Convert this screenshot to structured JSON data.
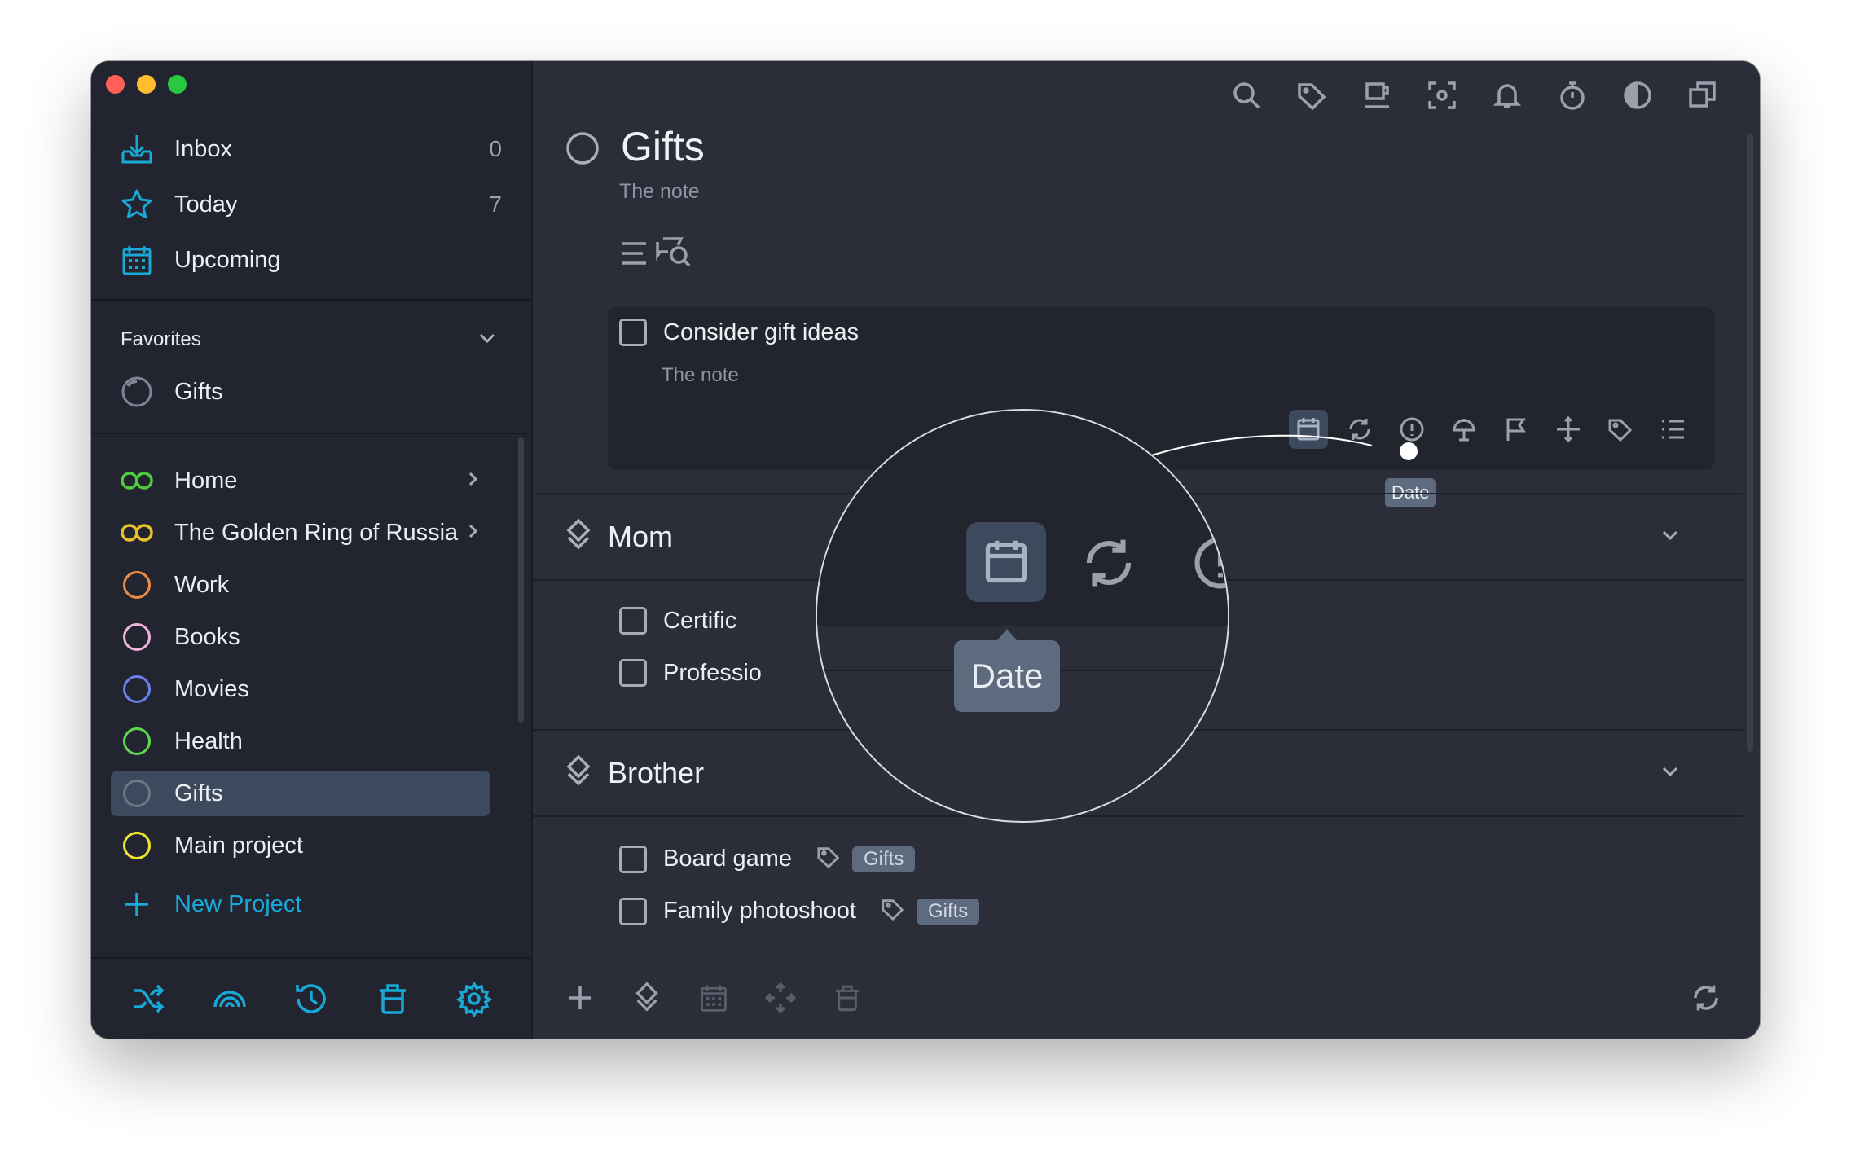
{
  "window": {
    "traffic_lights": {
      "close": "#ff5f57",
      "minimize": "#febc2e",
      "zoom": "#28c840"
    }
  },
  "sidebar": {
    "inbox": {
      "label": "Inbox",
      "count": "0",
      "icon": "inbox-icon"
    },
    "today": {
      "label": "Today",
      "count": "7",
      "icon": "star-icon"
    },
    "upcoming": {
      "label": "Upcoming",
      "icon": "calendar-icon"
    },
    "favorites": {
      "title": "Favorites",
      "items": [
        {
          "label": "Gifts",
          "icon": "circle-progress-icon"
        }
      ]
    },
    "projects": [
      {
        "label": "Home",
        "color": "#4ecb3c",
        "icon": "infinity-icon",
        "has_children": true
      },
      {
        "label": "The Golden Ring of Russia",
        "color": "#e8c12a",
        "icon": "infinity-icon",
        "has_children": true
      },
      {
        "label": "Work",
        "color": "#f08a44",
        "icon": "circle-icon"
      },
      {
        "label": "Books",
        "color": "#efb3dc",
        "icon": "circle-icon"
      },
      {
        "label": "Movies",
        "color": "#6b7fef",
        "icon": "circle-icon"
      },
      {
        "label": "Health",
        "color": "#5bd94a",
        "icon": "circle-icon"
      },
      {
        "label": "Gifts",
        "color": "#6e7688",
        "icon": "circle-icon",
        "selected": true
      },
      {
        "label": "Main project",
        "color": "#f1e52e",
        "icon": "circle-icon"
      }
    ],
    "new_project": "New Project",
    "accent": "#18a9d6",
    "bottom_icons": [
      "shuffle-icon",
      "rainbow-icon",
      "history-icon",
      "trash-icon",
      "gear-icon"
    ]
  },
  "toolbar": {
    "icons": [
      "search-icon",
      "tag-icon",
      "coffee-cup-icon",
      "focus-icon",
      "bell-icon",
      "stopwatch-icon",
      "contrast-icon",
      "windows-icon"
    ]
  },
  "project": {
    "title": "Gifts",
    "note": "The note",
    "tasks": [
      {
        "title": "Consider gift ideas",
        "note": "The note"
      }
    ],
    "task_actions": [
      "date-icon",
      "repeat-icon",
      "priority-icon",
      "reminder-icon",
      "flag-icon",
      "move-icon",
      "tag-icon",
      "checklist-icon"
    ],
    "tooltip": "Date",
    "headings": [
      {
        "title": "Mom",
        "tasks": [
          {
            "title": "Certific"
          },
          {
            "title": "Professio"
          }
        ]
      },
      {
        "title": "Brother",
        "tasks": [
          {
            "title": "Board game",
            "tag": "Gifts"
          },
          {
            "title": "Family photoshoot",
            "tag": "Gifts"
          }
        ]
      }
    ]
  },
  "magnifier": {
    "tooltip": "Date"
  },
  "main_bottom": {
    "icons": [
      "add-icon",
      "heading-icon",
      "calendar-icon",
      "move-icon",
      "trash-icon"
    ],
    "sync_icon": "sync-icon"
  }
}
